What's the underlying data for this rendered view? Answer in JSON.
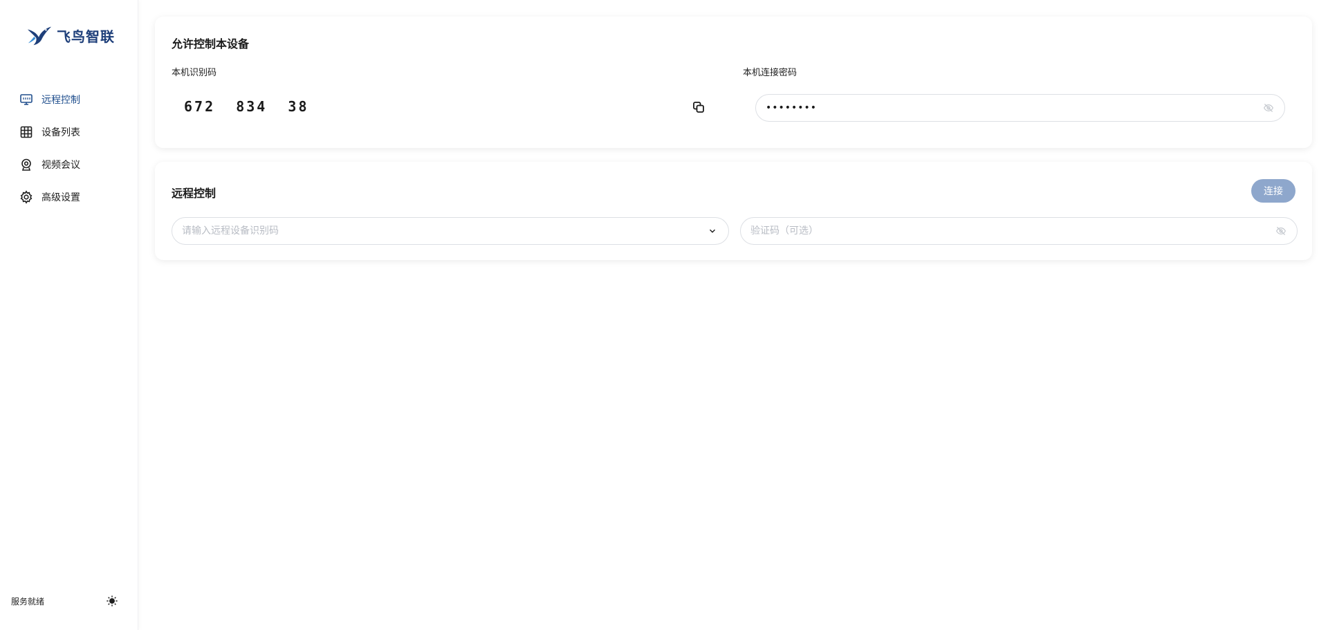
{
  "brand": {
    "name": "飞鸟智联",
    "logo_icon": "bird-logo-icon",
    "color": "#1e3f7a"
  },
  "sidebar": {
    "items": [
      {
        "label": "远程控制",
        "icon": "remote-desktop-icon",
        "active": true
      },
      {
        "label": "设备列表",
        "icon": "grid-icon",
        "active": false
      },
      {
        "label": "视频会议",
        "icon": "webcam-icon",
        "active": false
      },
      {
        "label": "高级设置",
        "icon": "gear-icon",
        "active": false
      }
    ],
    "status": "服务就绪",
    "theme_icon": "sun-icon"
  },
  "allow_control": {
    "title": "允许控制本设备",
    "id_label": "本机识别码",
    "device_id": "672  834  38",
    "password_label": "本机连接密码",
    "password_masked": "••••••••"
  },
  "remote_control": {
    "title": "远程控制",
    "connect_label": "连接",
    "id_placeholder": "请输入远程设备识别码",
    "code_placeholder": "验证码（可选）"
  },
  "colors": {
    "accent": "#1e4d8c",
    "connect_button": "#8ea7cc"
  }
}
